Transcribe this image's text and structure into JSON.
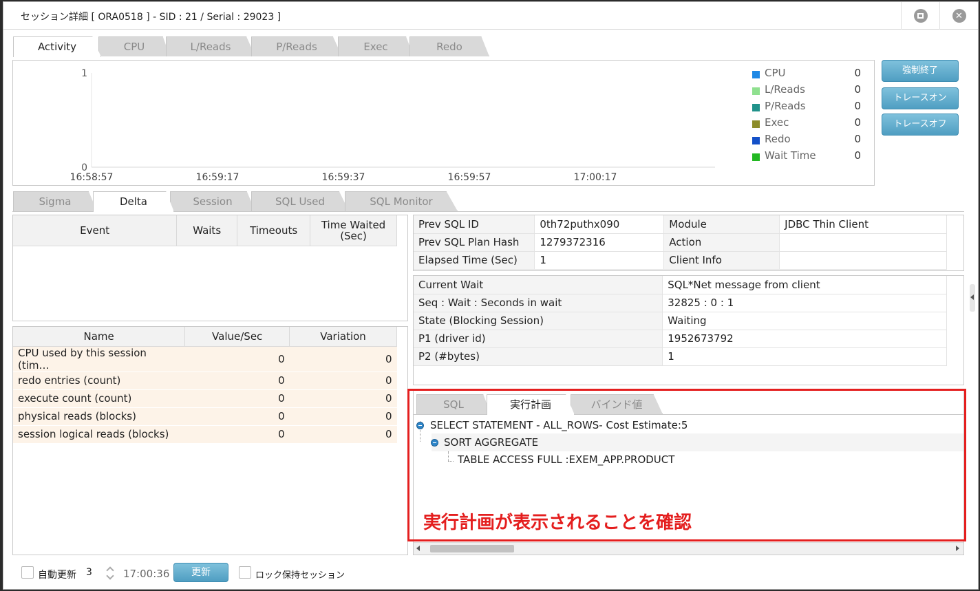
{
  "window": {
    "title": "セッション詳細 [ ORA0518 ] - SID : 21 / Serial : 29023 ]"
  },
  "top_tabs": [
    "Activity",
    "CPU",
    "L/Reads",
    "P/Reads",
    "Exec",
    "Redo"
  ],
  "chart_data": {
    "type": "line",
    "ylim": [
      0,
      1
    ],
    "y_ticks": [
      "1",
      "0"
    ],
    "x_ticks": [
      "16:58:57",
      "16:59:17",
      "16:59:37",
      "16:59:57",
      "17:00:17"
    ],
    "series": [
      {
        "name": "CPU",
        "color": "#1e88e5",
        "value": "0"
      },
      {
        "name": "L/Reads",
        "color": "#8fe08f",
        "value": "0"
      },
      {
        "name": "P/Reads",
        "color": "#20928a",
        "value": "0"
      },
      {
        "name": "Exec",
        "color": "#8d8d2a",
        "value": "0"
      },
      {
        "name": "Redo",
        "color": "#1350c8",
        "value": "0"
      },
      {
        "name": "Wait Time",
        "color": "#22b822",
        "value": "0"
      }
    ]
  },
  "side_buttons": [
    "強制終了",
    "トレースオン",
    "トレースオフ"
  ],
  "bottom_tabs": [
    "Sigma",
    "Delta",
    "Session",
    "SQL Used",
    "SQL Monitor"
  ],
  "events_table": {
    "headers": [
      "Event",
      "Waits",
      "Timeouts",
      "Time Waited\n(Sec)"
    ]
  },
  "stats_table": {
    "headers": [
      "Name",
      "Value/Sec",
      "Variation"
    ],
    "rows": [
      [
        "CPU used by this session (tim…",
        "0",
        "0"
      ],
      [
        "redo entries (count)",
        "0",
        "0"
      ],
      [
        "execute count (count)",
        "0",
        "0"
      ],
      [
        "physical reads (blocks)",
        "0",
        "0"
      ],
      [
        "session logical reads (blocks)",
        "0",
        "0"
      ]
    ]
  },
  "sql_info": [
    [
      "Prev SQL ID",
      "0th72puthx090",
      "Module",
      "JDBC Thin Client"
    ],
    [
      "Prev SQL Plan Hash",
      "1279372316",
      "Action",
      ""
    ],
    [
      "Elapsed Time (Sec)",
      "1",
      "Client Info",
      ""
    ]
  ],
  "wait_info": [
    [
      "Current Wait",
      "SQL*Net message from client"
    ],
    [
      "Seq : Wait : Seconds in wait",
      "32825 : 0 : 1"
    ],
    [
      "State (Blocking Session)",
      "Waiting"
    ],
    [
      "P1 (driver id)",
      "1952673792"
    ],
    [
      "P2 (#bytes)",
      "1"
    ]
  ],
  "plan_tabs": [
    "SQL",
    "実行計画",
    "バインド値"
  ],
  "plan_lines": [
    "SELECT STATEMENT - ALL_ROWS- Cost Estimate:5",
    "SORT AGGREGATE",
    "TABLE ACCESS FULL :EXEM_APP.PRODUCT"
  ],
  "annotation": "実行計画が表示されることを確認",
  "footer": {
    "auto_update_label": "自動更新",
    "interval": "3",
    "time": "17:00:36",
    "refresh_button": "更新",
    "lock_label": "ロック保持セッション"
  }
}
